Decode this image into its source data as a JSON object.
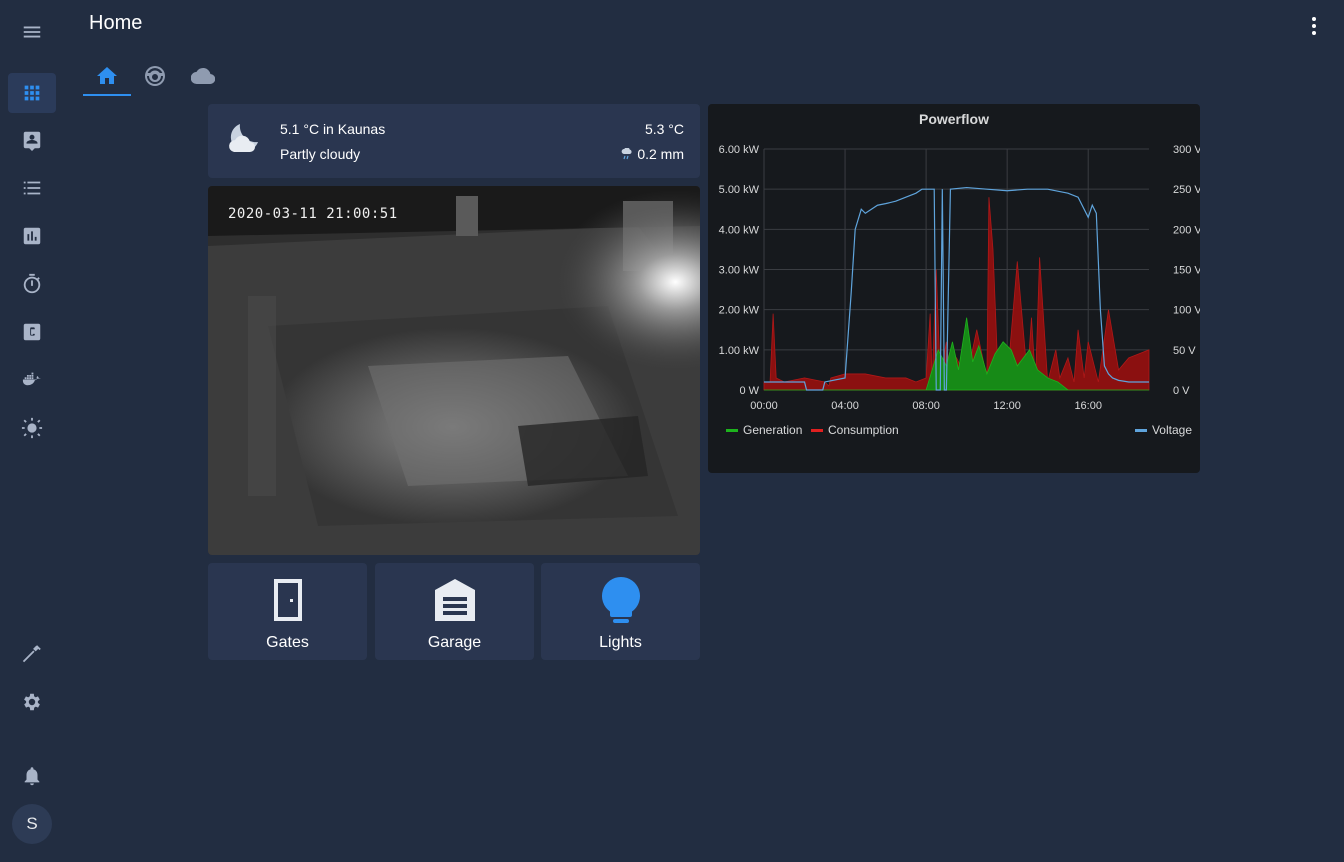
{
  "header": {
    "title": "Home"
  },
  "sidebar": {
    "items": [
      {
        "name": "menu",
        "icon": "hamburger-icon"
      },
      {
        "name": "overview",
        "icon": "grid-icon"
      },
      {
        "name": "map",
        "icon": "account-box-icon"
      },
      {
        "name": "logbook",
        "icon": "list-icon"
      },
      {
        "name": "history",
        "icon": "chart-bar-icon"
      },
      {
        "name": "timer",
        "icon": "timer-icon"
      },
      {
        "name": "codeserver",
        "icon": "alpha-c-box-icon"
      },
      {
        "name": "portainer",
        "icon": "docker-icon"
      },
      {
        "name": "sun",
        "icon": "sun-icon"
      },
      {
        "name": "developer-tools",
        "icon": "hammer-icon"
      },
      {
        "name": "configuration",
        "icon": "gear-icon"
      },
      {
        "name": "notifications",
        "icon": "bell-icon"
      }
    ],
    "avatar_initial": "S"
  },
  "tabs": [
    {
      "icon": "home-icon",
      "active": true
    },
    {
      "icon": "robot-vacuum-icon",
      "active": false
    },
    {
      "icon": "cloud-icon",
      "active": false
    }
  ],
  "weather": {
    "temp_location": "5.1 °C in Kaunas",
    "condition": "Partly cloudy",
    "temp_right": "5.3 °C",
    "precipitation": "0.2 mm"
  },
  "camera": {
    "timestamp": "2020-03-11 21:00:51"
  },
  "buttons": [
    {
      "label": "Gates",
      "icon": "door-icon"
    },
    {
      "label": "Garage",
      "icon": "garage-icon"
    },
    {
      "label": "Lights",
      "icon": "lightbulb-icon",
      "color": "#2e8ff0"
    }
  ],
  "colors": {
    "accent": "#2e8ff0",
    "generation": "#1db31d",
    "consumption": "#e02020",
    "voltage": "#5fa4dc"
  },
  "chart_data": {
    "type": "area",
    "title": "Powerflow",
    "x_ticks": [
      "00:00",
      "04:00",
      "08:00",
      "12:00",
      "16:00"
    ],
    "y_left_ticks": [
      "0 W",
      "1.00 kW",
      "2.00 kW",
      "3.00 kW",
      "4.00 kW",
      "5.00 kW",
      "6.00 kW"
    ],
    "y_right_ticks": [
      "0 V",
      "50 V",
      "100 V",
      "150 V",
      "200 V",
      "250 V",
      "300 V"
    ],
    "ylim_left": [
      0,
      6
    ],
    "ylim_right": [
      0,
      300
    ],
    "xlim": [
      0,
      19
    ],
    "legend": [
      "Generation",
      "Consumption",
      "Voltage"
    ],
    "series": [
      {
        "name": "Consumption",
        "x": [
          0,
          0.3,
          0.45,
          0.6,
          1,
          2,
          3,
          3.2,
          3.3,
          4,
          5,
          6,
          7,
          7.5,
          8,
          8.2,
          8.3,
          8.5,
          8.7,
          9,
          9.2,
          9.5,
          10,
          10.5,
          11,
          11.1,
          11.3,
          11.5,
          11.7,
          12,
          12.5,
          13,
          13.2,
          13.4,
          13.6,
          14,
          14.4,
          14.6,
          15,
          15.3,
          15.5,
          15.8,
          16,
          16.5,
          17,
          17.5,
          18,
          18.5,
          19
        ],
        "values": [
          0.2,
          0.2,
          1.9,
          0.3,
          0.2,
          0.3,
          0.2,
          0.1,
          0.3,
          0.4,
          0.4,
          0.3,
          0.3,
          0.2,
          0.3,
          1.9,
          0.2,
          3.0,
          0.3,
          1.2,
          0.2,
          0.8,
          0.3,
          1.5,
          0.3,
          4.8,
          3.5,
          1.0,
          0.4,
          0.2,
          3.2,
          0.3,
          1.8,
          0.2,
          3.3,
          0.2,
          1.0,
          0.3,
          0.8,
          0.2,
          1.5,
          0.3,
          1.2,
          0.2,
          2.0,
          0.5,
          0.8,
          0.9,
          1.0
        ]
      },
      {
        "name": "Generation",
        "x": [
          0,
          8,
          8.3,
          8.6,
          9,
          9.3,
          9.6,
          10,
          10.3,
          10.6,
          11,
          11.4,
          11.8,
          12.2,
          12.5,
          12.8,
          13.1,
          13.5,
          14,
          14.5,
          15,
          19
        ],
        "values": [
          0,
          0,
          0.5,
          1.0,
          0.6,
          1.2,
          0.5,
          1.8,
          0.7,
          1.1,
          0.4,
          0.9,
          1.2,
          1.0,
          0.6,
          0.8,
          1.0,
          0.5,
          0.3,
          0.2,
          0,
          0
        ]
      },
      {
        "name": "Voltage",
        "x": [
          0,
          2,
          2.1,
          2.9,
          3.0,
          4.0,
          4.1,
          4.3,
          4.5,
          4.8,
          5.0,
          5.3,
          5.6,
          6.0,
          6.5,
          7.0,
          7.5,
          7.8,
          8.2,
          8.4,
          8.5,
          8.7,
          8.8,
          8.9,
          9.0,
          9.2,
          10,
          11,
          12,
          13,
          14,
          15,
          15.5,
          15.8,
          16,
          16.2,
          16.4,
          16.6,
          16.8,
          17,
          17.2,
          17.5,
          18,
          19
        ],
        "values": [
          10,
          10,
          0,
          0,
          10,
          15,
          50,
          120,
          200,
          225,
          220,
          225,
          230,
          232,
          235,
          240,
          245,
          250,
          250,
          250,
          0,
          0,
          250,
          0,
          0,
          250,
          252,
          250,
          248,
          250,
          250,
          245,
          240,
          225,
          215,
          230,
          220,
          100,
          30,
          20,
          15,
          12,
          10,
          10
        ]
      }
    ]
  }
}
